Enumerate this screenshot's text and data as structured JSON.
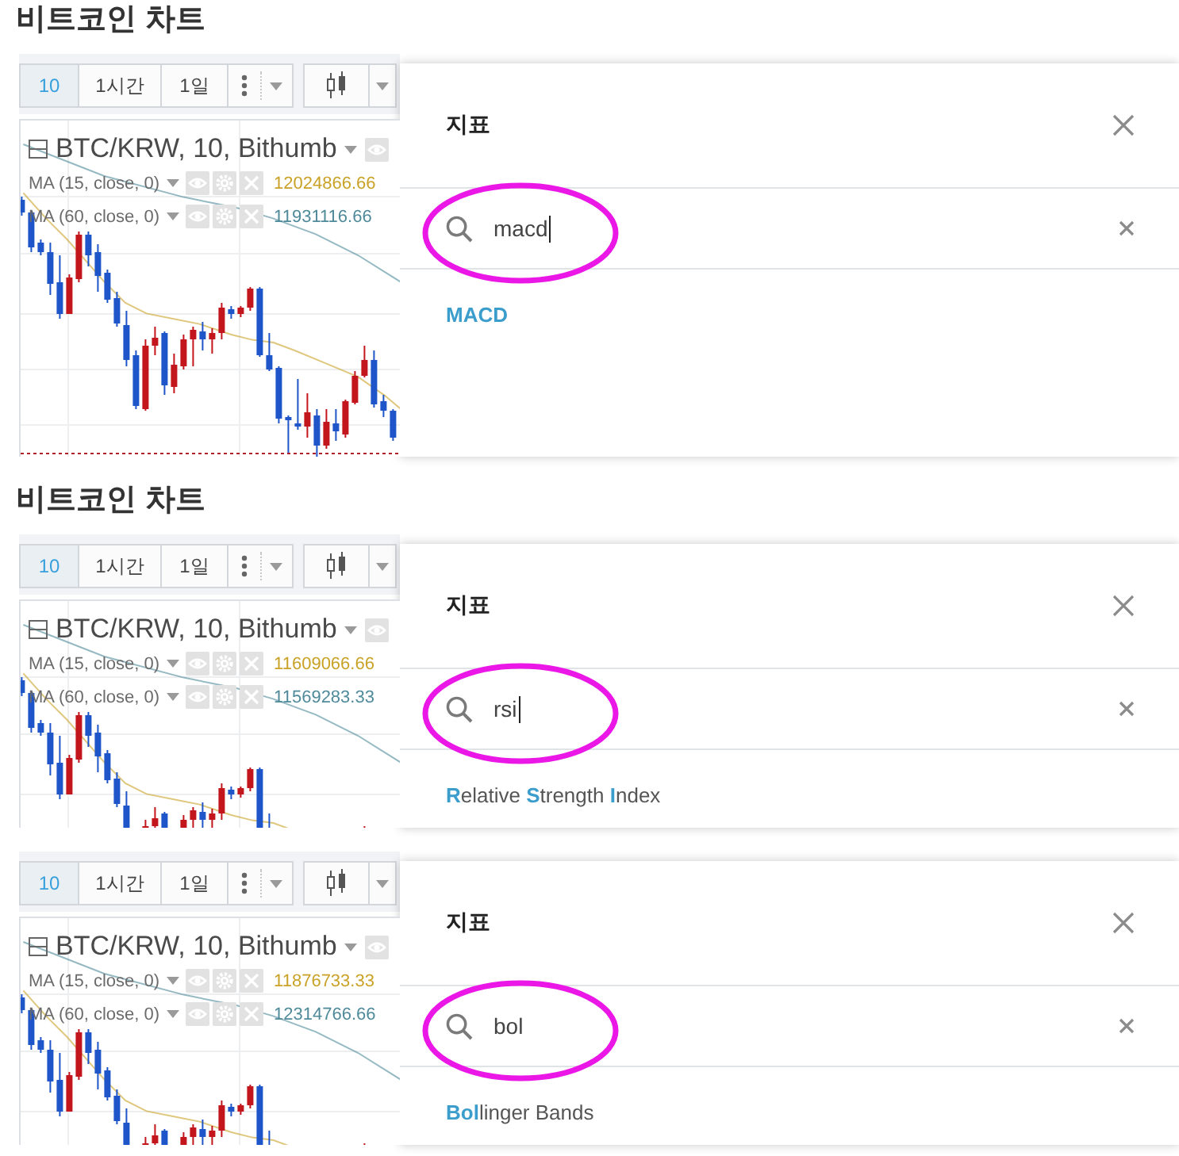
{
  "panels": [
    {
      "title": "비트코인 차트",
      "toolbar": {
        "intervals": [
          {
            "label": "10",
            "selected": true
          },
          {
            "label": "1시간",
            "selected": false
          },
          {
            "label": "1일",
            "selected": false
          }
        ]
      },
      "chart": {
        "cropped": false,
        "symbol": "BTC/KRW, 10, Bithumb",
        "studies": [
          {
            "label": "MA (15, close, 0)",
            "value": "12024866.66",
            "color": "#c9a227"
          },
          {
            "label": "MA (60, close, 0)",
            "value": "11931116.66",
            "color": "#4f8a9a"
          }
        ]
      },
      "dialog": {
        "title": "지표",
        "search": {
          "value": "macd",
          "cursor": true,
          "circled": true
        },
        "results": [
          {
            "segments": [
              {
                "text": "MACD",
                "match": true
              }
            ]
          }
        ]
      }
    },
    {
      "title": "비트코인 차트",
      "toolbar": {
        "intervals": [
          {
            "label": "10",
            "selected": true
          },
          {
            "label": "1시간",
            "selected": false
          },
          {
            "label": "1일",
            "selected": false
          }
        ]
      },
      "chart": {
        "cropped": true,
        "symbol": "BTC/KRW, 10, Bithumb",
        "studies": [
          {
            "label": "MA (15, close, 0)",
            "value": "11609066.66",
            "color": "#c9a227"
          },
          {
            "label": "MA (60, close, 0)",
            "value": "11569283.33",
            "color": "#4f8a9a"
          }
        ]
      },
      "dialog": {
        "title": "지표",
        "search": {
          "value": "rsi",
          "cursor": true,
          "circled": true
        },
        "results": [
          {
            "segments": [
              {
                "text": "R",
                "match": true
              },
              {
                "text": "elative ",
                "match": false
              },
              {
                "text": "S",
                "match": true
              },
              {
                "text": "trength ",
                "match": false
              },
              {
                "text": "I",
                "match": true
              },
              {
                "text": "ndex",
                "match": false
              }
            ]
          }
        ]
      }
    },
    {
      "toolbar": {
        "intervals": [
          {
            "label": "10",
            "selected": true
          },
          {
            "label": "1시간",
            "selected": false
          },
          {
            "label": "1일",
            "selected": false
          }
        ]
      },
      "chart": {
        "cropped": true,
        "symbol": "BTC/KRW, 10, Bithumb",
        "studies": [
          {
            "label": "MA (15, close, 0)",
            "value": "11876733.33",
            "color": "#c9a227"
          },
          {
            "label": "MA (60, close, 0)",
            "value": "12314766.66",
            "color": "#4f8a9a"
          }
        ]
      },
      "dialog": {
        "title": "지표",
        "search": {
          "value": "bol",
          "cursor": false,
          "circled": true
        },
        "results": [
          {
            "segments": [
              {
                "text": "Bol",
                "match": true
              },
              {
                "text": "linger Bands",
                "match": false
              }
            ]
          }
        ]
      }
    }
  ]
}
